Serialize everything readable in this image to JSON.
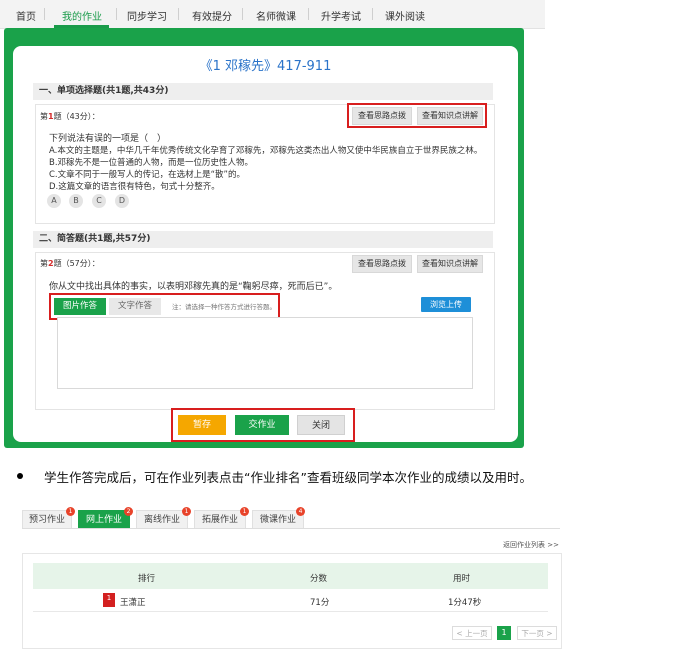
{
  "nav": {
    "items": [
      "首页",
      "我的作业",
      "同步学习",
      "有效提分",
      "名师微课",
      "升学考试",
      "课外阅读"
    ],
    "active_index": 1
  },
  "exam": {
    "title": "《1 邓稼先》417-911"
  },
  "section1": {
    "header": "一、单项选择题(共1题,共43分)",
    "question": {
      "number_prefix": "第",
      "number": "1",
      "number_suffix": "题（43分）：",
      "btn_hint": "查看思路点拨",
      "btn_knowledge": "查看知识点讲解",
      "stem": "下列说法有误的一项是（　）",
      "options": [
        "A.本文的主题是，中华几千年优秀传统文化孕育了邓稼先，邓稼先这类杰出人物又使中华民族自立于世界民族之林。",
        "B.邓稼先不是一位普通的人物，而是一位历史性人物。",
        "C.文章不同于一般写人的传记，在选材上是“散”的。",
        "D.这篇文章的语言很有特色，句式十分整齐。"
      ],
      "choices": [
        "A",
        "B",
        "C",
        "D"
      ]
    }
  },
  "section2": {
    "header": "二、简答题(共1题,共57分)",
    "question": {
      "number_prefix": "第",
      "number": "2",
      "number_suffix": "题（57分）：",
      "btn_hint": "查看思路点拨",
      "btn_knowledge": "查看知识点讲解",
      "stem": "你从文中找出具体的事实，以表明邓稼先真的是“鞠躬尽瘁，死而后已”。",
      "btn_picture": "图片作答",
      "btn_text": "文字作答",
      "hint": "注：请选择一种作答方式进行答题。",
      "btn_upload": "浏览上传"
    }
  },
  "actions": {
    "save": "暂存",
    "submit": "交作业",
    "close": "关闭"
  },
  "bullet": {
    "text": "学生作答完成后，可在作业列表点击“作业排名”查看班级同学本次作业的成绩以及用时。"
  },
  "homework": {
    "tabs": [
      {
        "label": "预习作业",
        "badge": "1"
      },
      {
        "label": "网上作业",
        "badge": "2"
      },
      {
        "label": "离线作业",
        "badge": "1"
      },
      {
        "label": "拓展作业",
        "badge": "1"
      },
      {
        "label": "微课作业",
        "badge": "4"
      }
    ],
    "active_tab": 1,
    "back_link": "返回作业列表 >>",
    "columns": [
      "排行",
      "分数",
      "用时"
    ],
    "rows": [
      {
        "rank": "1",
        "name": "王潇正",
        "score": "71分",
        "time": "1分47秒"
      }
    ],
    "pagination": {
      "prev": "< 上一页",
      "current": "1",
      "next": "下一页 >"
    }
  },
  "colors": {
    "brand_green": "#1aa24a",
    "title_blue": "#2a73c9",
    "highlight_red": "#d81e1e",
    "save_orange": "#f5a700",
    "upload_blue": "#1e8fd8"
  }
}
